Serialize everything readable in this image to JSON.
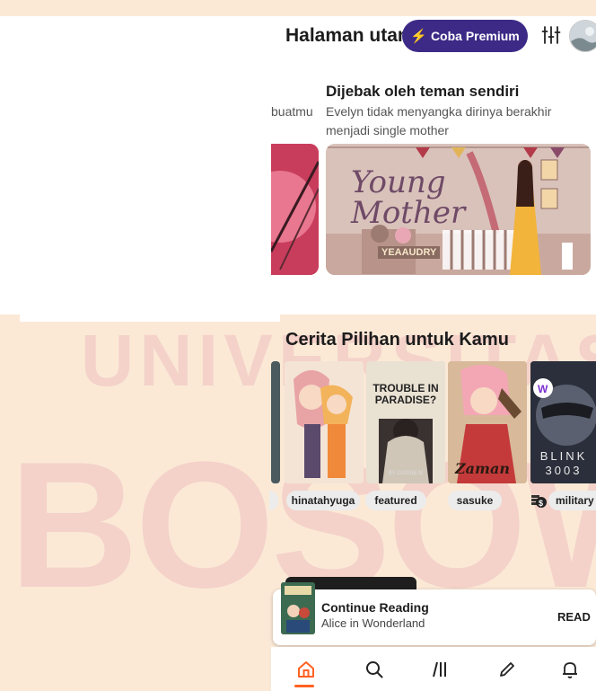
{
  "header": {
    "title": "Halaman utama",
    "premium_label": "Coba Premium"
  },
  "featured": {
    "prev_desc": "buatmu",
    "headline": "Dijebak oleh teman sendiri",
    "description": "Evelyn tidak menyangka dirinya berakhir menjadi single mother",
    "cover_title": "Young Mother",
    "cover_author": "YEAAUDRY"
  },
  "section": {
    "title": "Cerita Pilihan untuk Kamu",
    "books": [
      {
        "cover_text": ""
      },
      {
        "cover_text": "TROUBLE IN PARADISE?",
        "cover_author": "BY CASSIE.M"
      },
      {
        "cover_text": "Zaman"
      },
      {
        "cover_text": "BLINK 3003"
      }
    ],
    "tags": [
      "hinatahyuga",
      "featured",
      "sasuke",
      "military"
    ]
  },
  "continue_reading": {
    "label": "Continue Reading",
    "book": "Alice in Wonderland",
    "action": "READ"
  },
  "watermark": {
    "top_text": "UNIVERSITAS",
    "big_text": "BOSOWA"
  },
  "colors": {
    "premium_bg": "#3c2a86",
    "accent": "#ff6122",
    "tag_bg": "#ececec"
  }
}
